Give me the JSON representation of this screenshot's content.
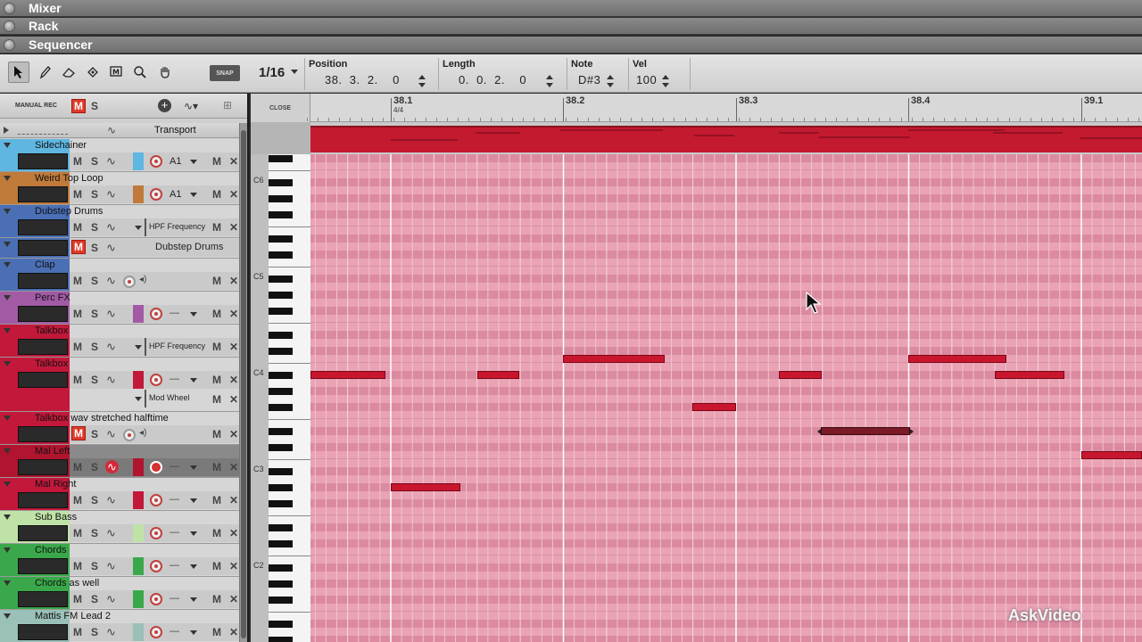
{
  "panels": {
    "mixer": "Mixer",
    "rack": "Rack",
    "sequencer": "Sequencer"
  },
  "toolbar": {
    "tools": [
      "select-arrow-icon",
      "pencil-icon",
      "eraser-icon",
      "razor-icon",
      "mute-tool-icon",
      "magnify-icon",
      "hand-icon"
    ],
    "snap_label": "SNAP",
    "grid_value": "1/16",
    "position": {
      "label": "Position",
      "value": "38.  3.  2.    0"
    },
    "length": {
      "label": "Length",
      "value": "0.  0.  2.    0"
    },
    "note": {
      "label": "Note",
      "value": "D#3"
    },
    "velocity": {
      "label": "Vel",
      "value": "100"
    }
  },
  "tracklist": {
    "manual_rec": "MANUAL REC",
    "m": "M",
    "s": "S",
    "transport": "Transport",
    "tracks": [
      {
        "name": "Sidechainer",
        "color": "#5fb6e0",
        "device": "A1"
      },
      {
        "name": "Weird Top Loop",
        "color": "#c07a3a",
        "device": "A1"
      },
      {
        "name": "Dubstep Drums",
        "color": "#4a6fb5",
        "device": "HPF Frequency"
      },
      {
        "name": "",
        "color": "#4a6fb5",
        "device": "Dubstep Drums"
      },
      {
        "name": "Clap",
        "color": "#4a6fb5",
        "device": ""
      },
      {
        "name": "Perc FX",
        "color": "#a25aa5",
        "device": "—"
      },
      {
        "name": "Talkbox",
        "color": "#c2183a",
        "device": "HPF Frequency"
      },
      {
        "name": "Talkbox",
        "color": "#c2183a",
        "device": "—",
        "device2": "Mod Wheel"
      },
      {
        "name": "Talkbox wav stretched halftime",
        "color": "#c2183a",
        "device": ""
      },
      {
        "name": "Mal Left",
        "color": "#b0142e",
        "device": "—"
      },
      {
        "name": "Mal Right",
        "color": "#c2183a",
        "device": "—"
      },
      {
        "name": "Sub Bass",
        "color": "#bfe3a7",
        "device": "—"
      },
      {
        "name": "Chords",
        "color": "#3aa84a",
        "device": "—"
      },
      {
        "name": "Chords as well",
        "color": "#3aa84a",
        "device": "—"
      },
      {
        "name": "Mattis FM Lead 2",
        "color": "#9ac0b8",
        "device": "—"
      }
    ]
  },
  "sequencer": {
    "close_label": "CLOSE",
    "bars": [
      "38.1",
      "38.2",
      "38.3",
      "38.4",
      "39.1"
    ],
    "time_signature": "4/4",
    "octaves": [
      "C6",
      "C5",
      "C4",
      "C3",
      "C2"
    ]
  },
  "watermark": "AskVideo",
  "colors": {
    "clip": "#c31a30",
    "grid_bg": "#e79aae",
    "note": "#c8162e",
    "note_selected": "#7a1a26"
  }
}
